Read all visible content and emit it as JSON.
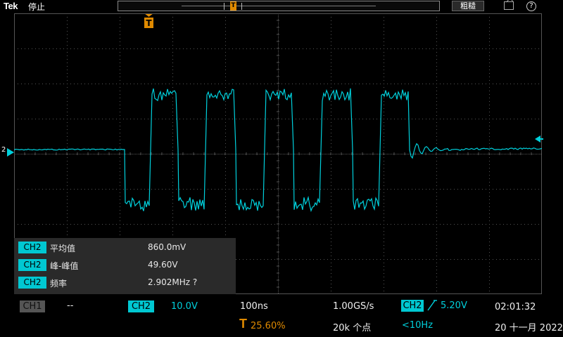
{
  "topbar": {
    "brand": "Tek",
    "run_state": "停止",
    "coarse_label": "粗糙",
    "help_glyph": "?"
  },
  "trigger_marker": {
    "glyph": "T"
  },
  "channel": {
    "marker_label": "2"
  },
  "measurements": [
    {
      "channel": "CH2",
      "name": "平均值",
      "value": "860.0mV"
    },
    {
      "channel": "CH2",
      "name": "峰-峰值",
      "value": "49.60V"
    },
    {
      "channel": "CH2",
      "name": "频率",
      "value": "2.902MHz ?"
    }
  ],
  "bottom": {
    "ch1_label": "CH1",
    "ch1_scale": "--",
    "ch2_label": "CH2",
    "ch2_scale": "10.0V",
    "timebase": "100ns",
    "sample_rate": "1.00GS/s",
    "trigger_source": "CH2",
    "trigger_level": "5.20V",
    "time": "02:01:32",
    "trigger_position_glyph": "T",
    "trigger_position": "25.60%",
    "record_length": "20k 个点",
    "trigger_freq": "<10Hz",
    "date": "20 十一月 2022"
  },
  "colors": {
    "trace": "#00d0dc",
    "trigger": "#e08a00",
    "grid": "#555555"
  }
}
